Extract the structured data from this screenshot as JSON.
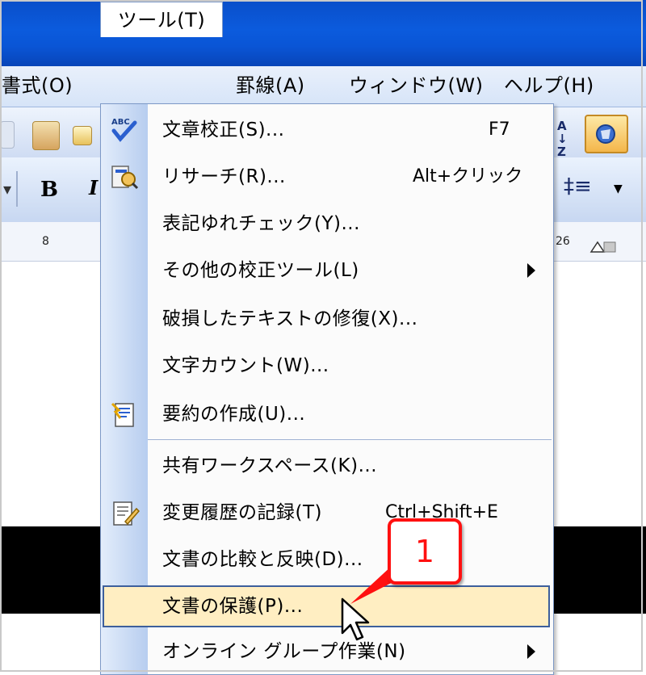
{
  "menubar": {
    "format": "書式(O)",
    "tools": "ツール(T)",
    "table": "罫線(A)",
    "window": "ウィンドウ(W)",
    "help": "ヘルプ(H)"
  },
  "toolbar": {
    "bold_label": "B"
  },
  "ruler": {
    "left_number": "8",
    "right_number": "26"
  },
  "tools_menu": {
    "items": [
      {
        "label": "文章校正(S)...",
        "shortcut": "F7",
        "icon": "spelling-check-icon"
      },
      {
        "label": "リサーチ(R)...",
        "shortcut": "Alt+クリック",
        "icon": "research-icon"
      },
      {
        "label": "表記ゆれチェック(Y)...",
        "shortcut": ""
      },
      {
        "label": "その他の校正ツール(L)",
        "shortcut": "",
        "submenu": true
      },
      {
        "label": "破損したテキストの修復(X)...",
        "shortcut": ""
      },
      {
        "label": "文字カウント(W)...",
        "shortcut": ""
      },
      {
        "label": "要約の作成(U)...",
        "shortcut": "",
        "icon": "autosummarize-icon"
      },
      {
        "label": "共有ワークスペース(K)...",
        "shortcut": ""
      },
      {
        "label": "変更履歴の記録(T)",
        "shortcut": "Ctrl+Shift+E",
        "icon": "track-changes-icon"
      },
      {
        "label": "文書の比較と反映(D)...",
        "shortcut": ""
      },
      {
        "label": "文書の保護(P)...",
        "shortcut": "",
        "highlighted": true
      },
      {
        "label": "オンライン グループ作業(N)",
        "shortcut": "",
        "submenu": true
      }
    ]
  },
  "callout": {
    "number": "1"
  },
  "colors": {
    "titlebar": "#0a55d6",
    "highlight_fill": "#ffeec2",
    "highlight_border": "#3d5f9c",
    "callout_red": "#ff1010"
  }
}
